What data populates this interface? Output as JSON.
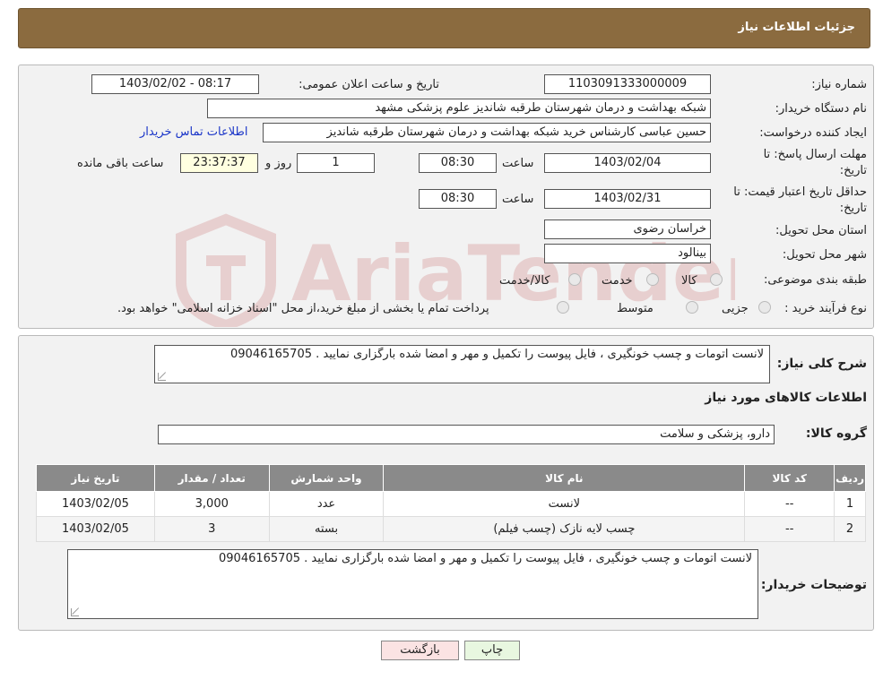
{
  "header": {
    "title": "جزئیات اطلاعات نیاز"
  },
  "info": {
    "need_number_label": "شماره نیاز:",
    "need_number": "1103091333000009",
    "announce_label": "تاریخ و ساعت اعلان عمومی:",
    "announce_value": "1403/02/02 - 08:17",
    "buyer_label": "نام دستگاه خریدار:",
    "buyer_value": "شبکه بهداشت و درمان شهرستان طرقبه شاندیز   علوم پزشکی مشهد",
    "creator_label": "ایجاد کننده درخواست:",
    "creator_value": "حسین عباسی کارشناس خرید شبکه بهداشت و درمان شهرستان طرقبه شاندیز",
    "contact_link": "اطلاعات تماس خریدار",
    "deadline_label_1": "مهلت ارسال پاسخ: تا",
    "deadline_label_2": "تاریخ:",
    "deadline_date": "1403/02/04",
    "time_label": "ساعت",
    "deadline_time": "08:30",
    "days_value": "1",
    "days_label": "روز و",
    "remaining_time": "23:37:37",
    "remaining_label": "ساعت باقی مانده",
    "validity_label_1": "حداقل تاریخ اعتبار قیمت: تا",
    "validity_label_2": "تاریخ:",
    "validity_date": "1403/02/31",
    "validity_time": "08:30",
    "province_label": "استان محل تحویل:",
    "province_value": "خراسان رضوی",
    "city_label": "شهر محل تحویل:",
    "city_value": "بینالود",
    "category_label": "طبقه بندی موضوعی:",
    "category_options": [
      "کالا",
      "خدمت",
      "کالا/خدمت"
    ],
    "process_label": "نوع فرآیند خرید :",
    "process_options": [
      "جزیی",
      "متوسط"
    ],
    "process_note": "پرداخت تمام یا بخشی از مبلغ خرید،از محل \"اسناد خزانه اسلامی\" خواهد بود."
  },
  "summary": {
    "label": "شرح کلی نیاز:",
    "value": "لانست اتومات و چسب خونگیری ، فایل پیوست را تکمیل و مهر و امضا شده بارگزاری نمایید . 09046165705"
  },
  "goods": {
    "section_title": "اطلاعات کالاهای مورد نیاز",
    "group_label": "گروه کالا:",
    "group_value": "دارو، پزشکی و سلامت",
    "columns": [
      "ردیف",
      "کد کالا",
      "نام کالا",
      "واحد شمارش",
      "تعداد / مقدار",
      "تاریخ نیاز"
    ],
    "rows": [
      [
        "1",
        "--",
        "لانست",
        "عدد",
        "3,000",
        "1403/02/05"
      ],
      [
        "2",
        "--",
        "چسب لایه نازک (چسب فیلم)",
        "بسته",
        "3",
        "1403/02/05"
      ]
    ]
  },
  "buyer_notes": {
    "label": "توضیحات خریدار:",
    "value": "لانست اتومات و چسب خونگیری ، فایل پیوست را تکمیل و مهر و امضا شده بارگزاری نمایید . 09046165705"
  },
  "buttons": {
    "print": "چاپ",
    "back": "بازگشت"
  },
  "watermark": {
    "text": "AriaTender.neT",
    "color": "#b11e1e"
  },
  "colors": {
    "header_bg": "#8b6b3f",
    "table_header_bg": "#8a8a8a",
    "link": "#1a35c8",
    "yellow_box": "#ffffe0",
    "print_btn": "#e8f7e0",
    "back_btn": "#fbe3e3"
  }
}
